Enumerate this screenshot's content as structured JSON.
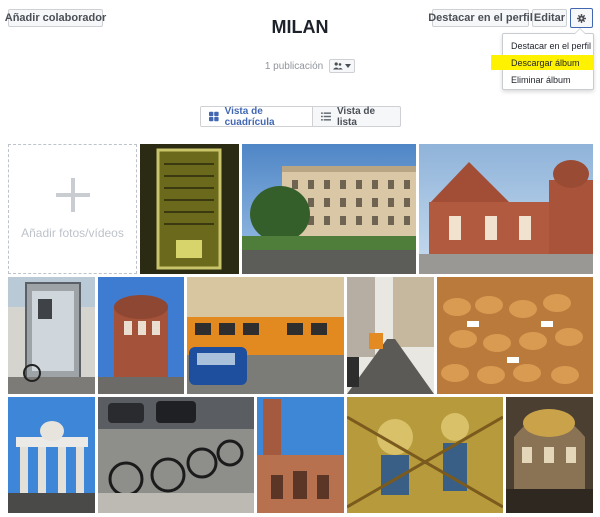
{
  "header": {
    "add_collaborator": "Añadir colaborador",
    "feature_button": "Destacar en el perfil",
    "edit_button": "Editar",
    "title": "MILAN",
    "publications": "1 publicación"
  },
  "menu": {
    "items": [
      "Destacar en el perfil",
      "Descargar álbum",
      "Eliminar álbum"
    ],
    "highlight_color": "#fff200"
  },
  "view": {
    "grid_label": "Vista de cuadrícula",
    "list_label": "Vista de lista"
  },
  "add_tile": {
    "label": "Añadir fotos/vídeos"
  },
  "colors": {
    "accent": "#4267b2",
    "border": "#ced0d4"
  }
}
